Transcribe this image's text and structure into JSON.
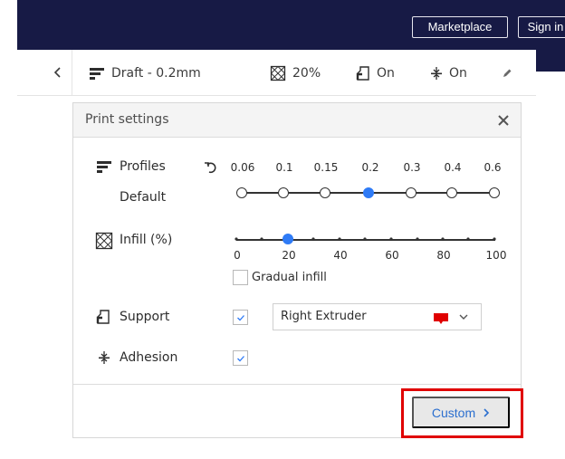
{
  "topbar": {
    "marketplace_label": "Marketplace",
    "signin_label": "Sign in"
  },
  "header": {
    "profile_label": "Draft - 0.2mm",
    "infill_label": "20%",
    "support_label": "On",
    "adhesion_label": "On"
  },
  "panel": {
    "title": "Print settings",
    "profiles": {
      "label": "Profiles",
      "sublabel": "Default",
      "values": [
        "0.06",
        "0.1",
        "0.15",
        "0.2",
        "0.3",
        "0.4",
        "0.6"
      ],
      "selected": "0.2"
    },
    "infill": {
      "label": "Infill (%)",
      "ticks": [
        "0",
        "20",
        "40",
        "60",
        "80",
        "100"
      ],
      "value": 20,
      "gradual_label": "Gradual infill",
      "gradual_checked": false
    },
    "support": {
      "label": "Support",
      "checked": true,
      "extruder": "Right Extruder",
      "extruder_color": "#e00000"
    },
    "adhesion": {
      "label": "Adhesion",
      "checked": true
    },
    "custom_label": "Custom"
  },
  "colors": {
    "topbar": "#171a45",
    "accent": "#2f7bf6",
    "link": "#2b6fcf",
    "highlight": "#e00000"
  }
}
